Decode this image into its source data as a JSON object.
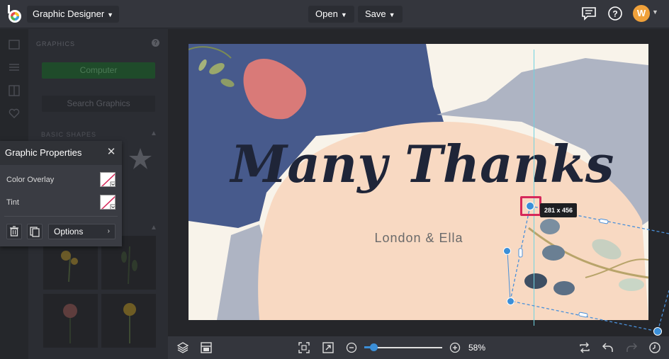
{
  "header": {
    "app_name": "Graphic Designer",
    "open_label": "Open",
    "save_label": "Save",
    "avatar_initial": "W"
  },
  "side_panel": {
    "title": "GRAPHICS",
    "computer_label": "Computer",
    "search_label": "Search Graphics",
    "basic_shapes_label": "BASIC SHAPES"
  },
  "graphic_properties": {
    "title": "Graphic Properties",
    "color_overlay_label": "Color Overlay",
    "tint_label": "Tint",
    "options_label": "Options"
  },
  "canvas": {
    "headline": "Many Thanks",
    "subline": "London & Ella",
    "size_tooltip": "281 x 456"
  },
  "bottom_toolbar": {
    "zoom_percent": "58%",
    "zoom_value": 0.58
  },
  "colors": {
    "accent_blue": "#3b8fd8",
    "highlight_pink": "#d6285a",
    "guide_cyan": "#6fd3e0",
    "canvas_navy": "#475a8c",
    "canvas_peach": "#f8d9c2",
    "text_dark": "#1f2538",
    "avatar_orange": "#f0a13a"
  },
  "icons": [
    "logo-icon",
    "chat-icon",
    "help-icon",
    "layers-icon",
    "template-icon",
    "fit-screen-icon",
    "expand-icon",
    "zoom-out-icon",
    "zoom-in-icon",
    "swap-icon",
    "undo-icon",
    "redo-icon",
    "history-icon",
    "trash-icon",
    "duplicate-icon",
    "close-icon"
  ]
}
